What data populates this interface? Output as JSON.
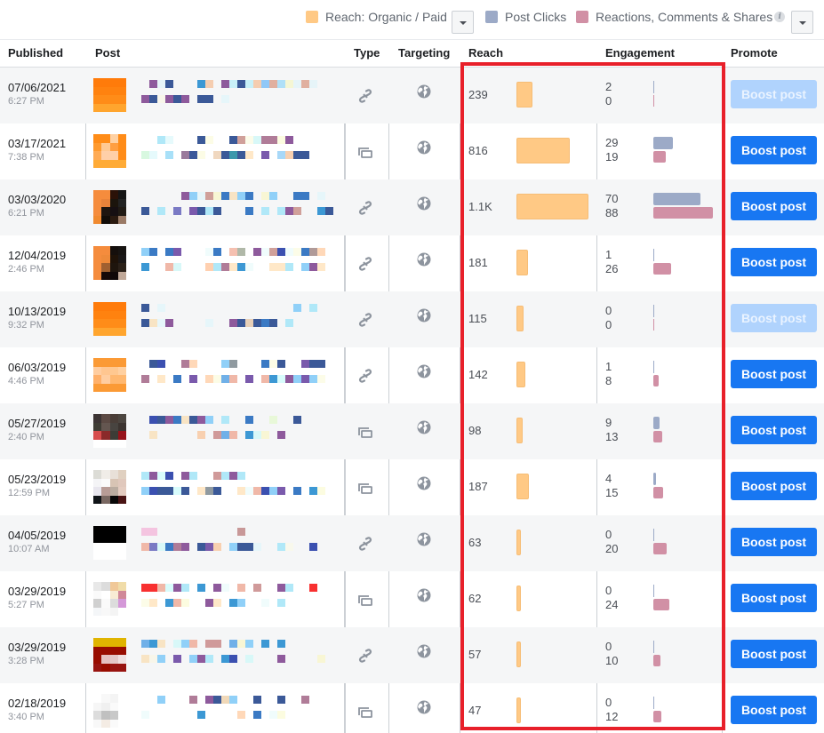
{
  "legend": {
    "reach_label": "Reach: Organic / Paid",
    "clicks_label": "Post Clicks",
    "reactions_label": "Reactions, Comments & Shares",
    "info_icon": "i",
    "colors": {
      "reach": "#ffc985",
      "clicks": "#9caac7",
      "reactions": "#d190a5"
    }
  },
  "columns": {
    "published": "Published",
    "post": "Post",
    "type": "Type",
    "targeting": "Targeting",
    "reach": "Reach",
    "engagement": "Engagement",
    "promote": "Promote"
  },
  "boost_label": "Boost post",
  "brand_color": "#1877f2",
  "highlight_color": "#e8202a",
  "rows": [
    {
      "date": "07/06/2021",
      "time": "6:27 PM",
      "type": "link",
      "targeting": "public",
      "reach": "239",
      "reach_num": 239,
      "clicks": "2",
      "reactions": "0",
      "boost_enabled": false
    },
    {
      "date": "03/17/2021",
      "time": "7:38 PM",
      "type": "album",
      "targeting": "public",
      "reach": "816",
      "reach_num": 816,
      "clicks": "29",
      "reactions": "19",
      "boost_enabled": true
    },
    {
      "date": "03/03/2020",
      "time": "6:21 PM",
      "type": "link",
      "targeting": "public",
      "reach": "1.1K",
      "reach_num": 1100,
      "clicks": "70",
      "reactions": "88",
      "boost_enabled": true
    },
    {
      "date": "12/04/2019",
      "time": "2:46 PM",
      "type": "link",
      "targeting": "public",
      "reach": "181",
      "reach_num": 181,
      "clicks": "1",
      "reactions": "26",
      "boost_enabled": true
    },
    {
      "date": "10/13/2019",
      "time": "9:32 PM",
      "type": "link",
      "targeting": "public",
      "reach": "115",
      "reach_num": 115,
      "clicks": "0",
      "reactions": "0",
      "boost_enabled": false
    },
    {
      "date": "06/03/2019",
      "time": "4:46 PM",
      "type": "link",
      "targeting": "public",
      "reach": "142",
      "reach_num": 142,
      "clicks": "1",
      "reactions": "8",
      "boost_enabled": true
    },
    {
      "date": "05/27/2019",
      "time": "2:40 PM",
      "type": "album",
      "targeting": "public",
      "reach": "98",
      "reach_num": 98,
      "clicks": "9",
      "reactions": "13",
      "boost_enabled": true
    },
    {
      "date": "05/23/2019",
      "time": "12:59 PM",
      "type": "album",
      "targeting": "public",
      "reach": "187",
      "reach_num": 187,
      "clicks": "4",
      "reactions": "15",
      "boost_enabled": true
    },
    {
      "date": "04/05/2019",
      "time": "10:07 AM",
      "type": "link",
      "targeting": "public",
      "reach": "63",
      "reach_num": 63,
      "clicks": "0",
      "reactions": "20",
      "boost_enabled": true
    },
    {
      "date": "03/29/2019",
      "time": "5:27 PM",
      "type": "album",
      "targeting": "public",
      "reach": "62",
      "reach_num": 62,
      "clicks": "0",
      "reactions": "24",
      "boost_enabled": true
    },
    {
      "date": "03/29/2019",
      "time": "3:28 PM",
      "type": "link",
      "targeting": "public",
      "reach": "57",
      "reach_num": 57,
      "clicks": "0",
      "reactions": "10",
      "boost_enabled": true
    },
    {
      "date": "02/18/2019",
      "time": "3:40 PM",
      "type": "album",
      "targeting": "public",
      "reach": "47",
      "reach_num": 47,
      "clicks": "0",
      "reactions": "12",
      "boost_enabled": true
    }
  ],
  "thumbs": [
    [
      "#ff7b0a",
      "#ff7b0a",
      "#ff7b0a",
      "#ff7b0a",
      "#ff820f",
      "#ff820f",
      "#ff820f",
      "#ff820f",
      "#ff8c18",
      "#ff8c18",
      "#ff8c18",
      "#ff8c18",
      "#ffa52e",
      "#ffa52e",
      "#ffa52e",
      "#ffa52e"
    ],
    [
      "#ff8c18",
      "#ff8c18",
      "#ffd1a3",
      "#ff8c18",
      "#ff9a2e",
      "#ffc993",
      "#ff9f42",
      "#ff8c18",
      "#ffab55",
      "#ffcfa8",
      "#ffcfa8",
      "#ff8c18",
      "#ffab36",
      "#ffab36",
      "#ffab36",
      "#ffab36"
    ],
    [
      "#f58c3d",
      "#f58c3d",
      "#2b1208",
      "#151515",
      "#f58c3d",
      "#e8833a",
      "#1b140c",
      "#222222",
      "#f58c3d",
      "#1e150f",
      "#160f12",
      "#201a14",
      "#f08a30",
      "#120d08",
      "#2a1a10",
      "#9a7a66"
    ],
    [
      "#f58c3d",
      "#f58c3d",
      "#150f0c",
      "#171412",
      "#f58c3d",
      "#ee8a3a",
      "#1e1208",
      "#1a1717",
      "#f58c3d",
      "#a06030",
      "#1e150d",
      "#2a2018",
      "#f58c3d",
      "#150808",
      "#0f0808",
      "#c0a898"
    ],
    [
      "#ff7b0a",
      "#ff7b0a",
      "#ff7b0a",
      "#ff7b0a",
      "#ff820f",
      "#ff820f",
      "#ff820f",
      "#ff820f",
      "#ff8c18",
      "#ff8c18",
      "#ff8c18",
      "#ff8c18",
      "#ffa52e",
      "#ffa52e",
      "#ffa52e",
      "#ffa52e"
    ],
    [
      "#fb9a35",
      "#fb9a35",
      "#fb9a35",
      "#fb9a35",
      "#ffcda0",
      "#ffc690",
      "#ffc890",
      "#ffd0a0",
      "#ffb06a",
      "#ffcda0",
      "#ffb870",
      "#ffb870",
      "#fb9a35",
      "#fb9a35",
      "#fb9a35",
      "#fb9a35"
    ],
    [
      "#3c3434",
      "#5c4a44",
      "#4a3e38",
      "#4c4640",
      "#3e3c34",
      "#645650",
      "#484440",
      "#3c3430",
      "#d64c4c",
      "#8a2a2a",
      "#3c3c36",
      "#96121a",
      "#ffffff",
      "#ffffff",
      "#ffffff",
      "#ffffff"
    ],
    [
      "#dcdcd6",
      "#f0ede8",
      "#e8e0d8",
      "#e0d0c0",
      "#f4f4f6",
      "#fafafa",
      "#d8c4b4",
      "#e0c8bc",
      "#e8e6ee",
      "#b89c96",
      "#baaca0",
      "#e4ccc0",
      "#101418",
      "#7a6862",
      "#080808",
      "#4a1414"
    ],
    [
      "#000000",
      "#000000",
      "#000000",
      "#000000",
      "#000000",
      "#000000",
      "#000000",
      "#000000",
      "#ffffff",
      "#ffffff",
      "#ffffff",
      "#ffffff",
      "#ffffff",
      "#ffffff",
      "#ffffff",
      "#ffffff"
    ],
    [
      "#e8e8e8",
      "#dcdcdc",
      "#f0c898",
      "#f0dca8",
      "#fafafa",
      "#ffffff",
      "#f8ecd4",
      "#d08898",
      "#d0d0d0",
      "#fafafa",
      "#dcdcdc",
      "#d498d8",
      "#f4f6f8",
      "#f8f8f8",
      "#f4f4f4",
      "#ffffff"
    ],
    [
      "#e0b400",
      "#e0b400",
      "#e0b400",
      "#e0b400",
      "#980c00",
      "#980c00",
      "#980c00",
      "#980c00",
      "#980c00",
      "#e4c0c0",
      "#e4c8c8",
      "#f0e0e0",
      "#981410",
      "#980c00",
      "#981410",
      "#981410"
    ],
    [
      "#ffffff",
      "#f8f8f8",
      "#f4f4f4",
      "#ffffff",
      "#f6f6f6",
      "#f0f0f0",
      "#fafafa",
      "#ffffff",
      "#dcdcdc",
      "#c0c0c0",
      "#c8c8c8",
      "#ffffff",
      "#f8f8f8",
      "#f4ece4",
      "#fafafa",
      "#ffffff"
    ]
  ],
  "text_pixels": [
    [
      [
        "",
        "",
        "#8e5a9c",
        "#e6f4f8",
        "#3b5998",
        "",
        "",
        "",
        "#3c98d4",
        "#f5cdb0",
        "",
        "#8e5a9c",
        "#c8f0f8",
        "#3b5998",
        "#c8f0f8",
        "#f5cdb0",
        "#90c8f8",
        "#e0b0a0",
        "#b0e0f8",
        "#f5f6d4",
        "#e6f4f8",
        "#e0b0a0",
        "#e6f4f8"
      ],
      [
        "",
        "#8e5a9c",
        "#3b5998",
        "#f8f6ea",
        "#8e5a9c",
        "#3b5998",
        "#8e5a9c",
        "",
        "#3b5998",
        "#3b5998",
        "",
        "#e6f6fa"
      ]
    ],
    [
      [
        "",
        "",
        "",
        "#b0e8f8",
        "#e6fafc",
        "",
        "",
        "",
        "#3b5998",
        "#fcfce6",
        "",
        "",
        "#3b5998",
        "#d0a09a",
        "#fcfcea",
        "#d8f8f8",
        "#b07c98",
        "#b07c98",
        "#fcfce0",
        "#8e5a9c"
      ],
      [
        "",
        "#d8f8e0",
        "#e6fafc",
        "",
        "#a8e0f8",
        "",
        "#9a7a9c",
        "#3b5998",
        "#fcfce6",
        "",
        "#f0d8c0",
        "#3b5998",
        "#3c98ac",
        "#3b5998",
        "#ffe8c8",
        "",
        "#7a5aac",
        "",
        "#a8d8f8",
        "#f8d0b0",
        "#3b5998",
        "#3b5998"
      ]
    ],
    [
      [
        "",
        "",
        "",
        "",
        "",
        "",
        "#8e5a9c",
        "#90d0f8",
        "#e6f6fa",
        "#d0a09a",
        "#f8f6d4",
        "#3b7ac4",
        "#f8e4c4",
        "#90d0f8",
        "#3b7ac4",
        "",
        "#f8f6d4",
        "#90d0f8",
        "",
        "",
        "#3b7ac4",
        "#3b7ac4",
        "",
        "#e6f6fa"
      ],
      [
        "",
        "#3b5998",
        "",
        "#b0e8f8",
        "",
        "#7a7ac4",
        "",
        "#7a5aac",
        "#3b5998",
        "#b0e8f8",
        "#3b5998",
        "",
        "",
        "",
        "#3b7ac4",
        "",
        "#b0e8f8",
        "",
        "#b0e8f8",
        "#8e5a9c",
        "#d0a09a",
        "",
        "",
        "#3c98d4",
        "#3b5998"
      ]
    ],
    [
      [
        "",
        "#90d0f8",
        "#3b7ac4",
        "",
        "#3b7ac4",
        "#7a5aac",
        "",
        "",
        "",
        "#f0fcfc",
        "#3b7ac4",
        "",
        "#f5c0b0",
        "#b0b8a8",
        "",
        "#8e5a9c",
        "#f0fcfc",
        "#d0a09a",
        "#3b50b0",
        "#f0fcfc",
        "#fcfce8",
        "#3b7ac4",
        "#b09a98",
        "#ffd8b8"
      ],
      [
        "",
        "#3c98d4",
        "",
        "",
        "#f0b8a8",
        "#d8f8f8",
        "",
        "",
        "",
        "#ffd0b0",
        "#b0e8f8",
        "#b07c98",
        "#ffe8c8",
        "#3c98d4",
        "#f0fcfc",
        "",
        "",
        "#ffe8c8",
        "#ffe8c8",
        "#b0e8f8",
        "",
        "#90d0f8",
        "#8e5a9c",
        "#ffe8c8"
      ]
    ],
    [
      [
        "",
        "#3b5998",
        "",
        "#e6f6fa",
        "",
        "",
        "",
        "",
        "",
        "",
        "",
        "",
        "",
        "",
        "",
        "",
        "",
        "",
        "",
        "",
        "#90d0f8",
        "",
        "#b0e8f8"
      ],
      [
        "",
        "#3b5998",
        "#f8e4c4",
        "#e6f6fa",
        "#8e5a9c",
        "",
        "",
        "",
        "",
        "#e6f6fa",
        "",
        "",
        "#8e5a9c",
        "#3b5998",
        "#e8d0b8",
        "#3b5998",
        "#3b7ac4",
        "#3b5998",
        "",
        "#b0e8f8"
      ]
    ],
    [
      [
        "",
        "",
        "#3b5998",
        "#3b50b0",
        "",
        "",
        "#b07c98",
        "#ffd8b8",
        "",
        "",
        "",
        "#90d0f8",
        "#909aa0",
        "",
        "",
        "",
        "#3b7ac4",
        "#fcfce6",
        "#3b5998",
        "",
        "",
        "#7a5aac",
        "#3b5998",
        "#3b5998"
      ],
      [
        "",
        "#b07c98",
        "",
        "#ffe8c8",
        "",
        "#3b7ac4",
        "",
        "#7a5aac",
        "",
        "#ffd8b8",
        "#fcfce6",
        "#70b0e8",
        "#f0b8a8",
        "",
        "#7a5aac",
        "",
        "#f0b8a8",
        "#3c98d4",
        "#d8fcfc",
        "#8e5a9c",
        "#90d0f8",
        "#7a5aac",
        "#90d0f8",
        "#fcfce8"
      ]
    ],
    [
      [
        "",
        "",
        "#3b50b0",
        "#3b5998",
        "#8e5a9c",
        "#3b7ac4",
        "#f8e4c4",
        "#3b5998",
        "#8e5a9c",
        "#90d0f8",
        "",
        "#b0e8f8",
        "",
        "",
        "#3b7ac4",
        "",
        "",
        "#e8f8d8",
        "",
        "",
        "#3b5998"
      ],
      [
        "",
        "",
        "#f8e4c4",
        "",
        "",
        "",
        "",
        "",
        "#f8d0b0",
        "",
        "#d09a9a",
        "#70b0e8",
        "#f0b8a8",
        "",
        "#3c98d4",
        "#d8f8f8",
        "#f8f6d4",
        "",
        "#8e5a9c"
      ]
    ],
    [
      [
        "",
        "#b0e8f8",
        "#8e5a9c",
        "#d8fcfc",
        "#3b50b0",
        "",
        "#8e5a9c",
        "#b0e8f8",
        "",
        "",
        "#d09a9a",
        "#b0e8f8",
        "#8e5a9c",
        "#b0e8f8"
      ],
      [
        "",
        "#90d0f8",
        "#3b50b0",
        "#3b5998",
        "#3b5998",
        "#d8fcfc",
        "#3b5998",
        "",
        "#ffe8c8",
        "#909aa0",
        "#3b5998",
        "",
        "",
        "#ffe8c8",
        "#f0fcfc",
        "#f0b8a8",
        "#3b50b0",
        "#90d0f8",
        "#7a5aac",
        "",
        "#3b7ac4",
        "",
        "#3c98d4",
        "#fcfce0"
      ]
    ],
    [
      [
        "",
        "#f4c4e0",
        "#f4c4e0",
        "",
        "",
        "",
        "",
        "",
        "",
        "",
        "",
        "",
        "",
        "#c89898"
      ],
      [
        "",
        "#f0b8a8",
        "#7a7ac4",
        "#d8f8f8",
        "#3b7ac4",
        "#b07c98",
        "#8e5a9c",
        "",
        "#3b5998",
        "#7a5aac",
        "#f8d0b0",
        "",
        "#90d0f8",
        "#3b5998",
        "#3b5998",
        "#e6f6fa",
        "",
        "",
        "#b0e8f8",
        "#f8f8ec",
        "",
        "",
        "#3b50b0"
      ]
    ],
    [
      [
        "",
        "#f83030",
        "#f83030",
        "#f0b8a8",
        "#d8fcfc",
        "#8e5a9c",
        "#b0e8f8",
        "",
        "#3c98d4",
        "",
        "#8e5a9c",
        "#f0fcfc",
        "",
        "#f0b8a8",
        "",
        "#d09a9a",
        "",
        "",
        "#8e5a9c",
        "#b0e8f8",
        "",
        "",
        "#f83030"
      ],
      [
        "",
        "#fcfce8",
        "#ffe8c8",
        "",
        "#3c98d4",
        "#f0b8a8",
        "#fcfce0",
        "",
        "",
        "#8e5a9c",
        "#ffe8c8",
        "",
        "#3c98d4",
        "#90d0f8",
        "",
        "",
        "#f0fcfc",
        "",
        "#b0e8f8"
      ]
    ],
    [
      [
        "",
        "#70b0e8",
        "#3c98d4",
        "#f8e4c4",
        "",
        "#d8f8f8",
        "#90d0f8",
        "#f0b8a8",
        "",
        "#d09a9a",
        "#d09a9a",
        "",
        "#70b0e8",
        "#f8f6d4",
        "#90d0f8",
        "",
        "#3c98d4",
        "",
        "#3c98d4"
      ],
      [
        "",
        "#f8e4c4",
        "#f8f6ea",
        "#90d0f8",
        "",
        "#7a5aac",
        "",
        "#90d0f8",
        "#8e5a9c",
        "#b0e8f8",
        "",
        "#3c98d4",
        "#3b50b0",
        "",
        "#d8f8f8",
        "",
        "",
        "",
        "#8e5a9c",
        "",
        "",
        "",
        "",
        "#f8f6d4"
      ]
    ],
    [
      [
        "",
        "",
        "",
        "#90d0f8",
        "",
        "",
        "",
        "#b07c98",
        "",
        "#8e5a9c",
        "#3b5998",
        "#f0d8b8",
        "#90d0f8",
        "",
        "",
        "#3b5998",
        "",
        "",
        "#3b5998",
        "",
        "",
        "#b07c98"
      ],
      [
        "",
        "#f0fcfc",
        "",
        "",
        "",
        "",
        "",
        "",
        "#3c98d4",
        "",
        "",
        "",
        "",
        "#ffd8b8",
        "",
        "#3b7ac4",
        "",
        "#f0fcfc",
        "#fcfce0"
      ]
    ]
  ]
}
